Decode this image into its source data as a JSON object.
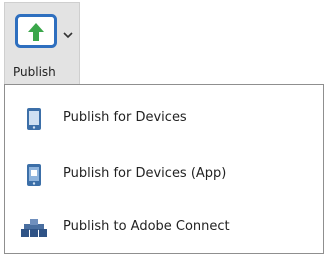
{
  "ribbon": {
    "publish_label": "Publish",
    "publish_icon": "publish-upload-icon",
    "dropdown_icon": "chevron-down-icon",
    "accent_color": "#2e6fbf",
    "arrow_color": "#3aa64a"
  },
  "menu": {
    "items": [
      {
        "label": "Publish for Devices",
        "icon": "mobile-device-icon"
      },
      {
        "label": "Publish for Devices (App)",
        "icon": "mobile-app-icon"
      },
      {
        "label": "Publish to Adobe Connect",
        "icon": "adobe-connect-icon"
      }
    ]
  }
}
